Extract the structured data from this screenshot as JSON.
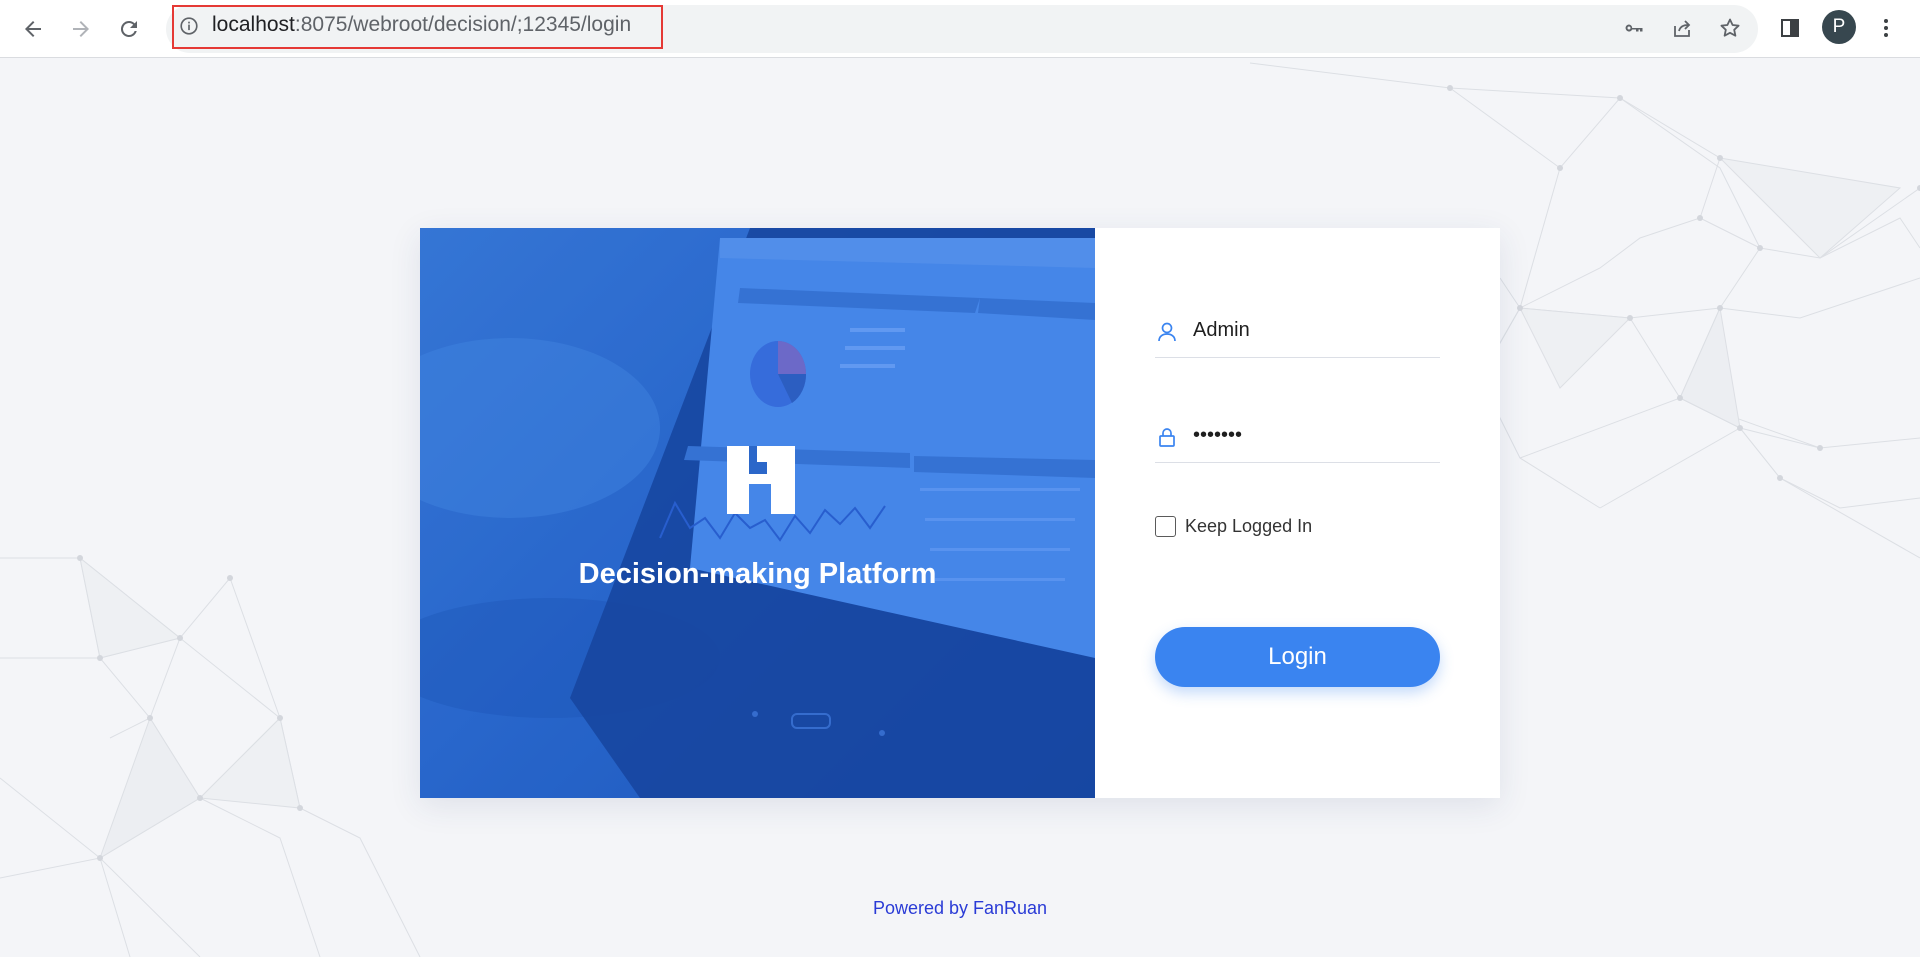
{
  "browser": {
    "url_host": "localhost",
    "url_rest": ":8075/webroot/decision/;12345/login",
    "profile_initial": "P",
    "icons": {
      "back": "arrow-left-icon",
      "forward": "arrow-right-icon",
      "reload": "reload-icon",
      "site_info": "info-circle-icon",
      "passwords": "key-icon",
      "share": "share-icon",
      "bookmark": "star-icon",
      "side_panel": "side-panel-icon",
      "menu": "kebab-menu-icon"
    },
    "highlight_color": "#e53935"
  },
  "hero": {
    "title": "Decision-making Platform",
    "logo": "fanruan-logo"
  },
  "login_form": {
    "username_value": "Admin",
    "password_value": "•••••••",
    "keep_logged_in_label": "Keep Logged In",
    "keep_logged_in_checked": false,
    "login_button_label": "Login",
    "username_icon": "user-icon",
    "password_icon": "lock-icon"
  },
  "footer": {
    "text": "Powered by FanRuan"
  },
  "colors": {
    "accent": "#3a84f0",
    "hero_blue": "#2a68cc",
    "footer_link": "#2a3bd6",
    "page_bg": "#f4f5f8"
  }
}
